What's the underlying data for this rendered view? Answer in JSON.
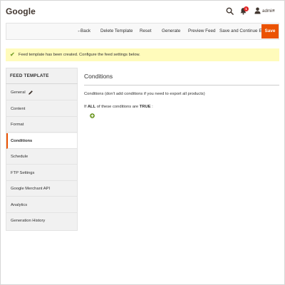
{
  "header": {
    "title": "Google",
    "notification_count": "1",
    "user_name": "admin",
    "user_caret": "▾"
  },
  "toolbar": {
    "back_arrow": "←",
    "back_label": "Back",
    "delete_label": "Delete Template",
    "reset_label": "Reset",
    "generate_label": "Generate",
    "preview_label": "Preview Feed",
    "save_continue_label": "Save and Continue Edit",
    "save_label": "Save"
  },
  "message": {
    "icon": "✔",
    "text": "Feed template has been created. Configure the feed settings below."
  },
  "tabs": {
    "title": "FEED TEMPLATE",
    "items": [
      {
        "label": "General"
      },
      {
        "label": "Content"
      },
      {
        "label": "Format"
      },
      {
        "label": "Conditions"
      },
      {
        "label": "Schedule"
      },
      {
        "label": "FTP Settings"
      },
      {
        "label": "Google Merchant API"
      },
      {
        "label": "Analytics"
      },
      {
        "label": "Generation History"
      }
    ],
    "active": "Conditions"
  },
  "main": {
    "section_title": "Conditions",
    "note": "Conditions (don't add conditions if you need to export all products)",
    "rule": {
      "prefix": "If",
      "aggregator": "ALL",
      "middle": "of these conditions are",
      "value": "TRUE",
      "suffix": ":"
    }
  },
  "colors": {
    "accent": "#eb5202",
    "message_bg": "#fffbbb",
    "success_check": "#79a22e",
    "badge": "#e22626",
    "add_icon": "#79a22e"
  },
  "icons": [
    "search-icon",
    "bell-icon",
    "user-icon",
    "pencil-icon",
    "add-condition-icon",
    "check-icon"
  ]
}
